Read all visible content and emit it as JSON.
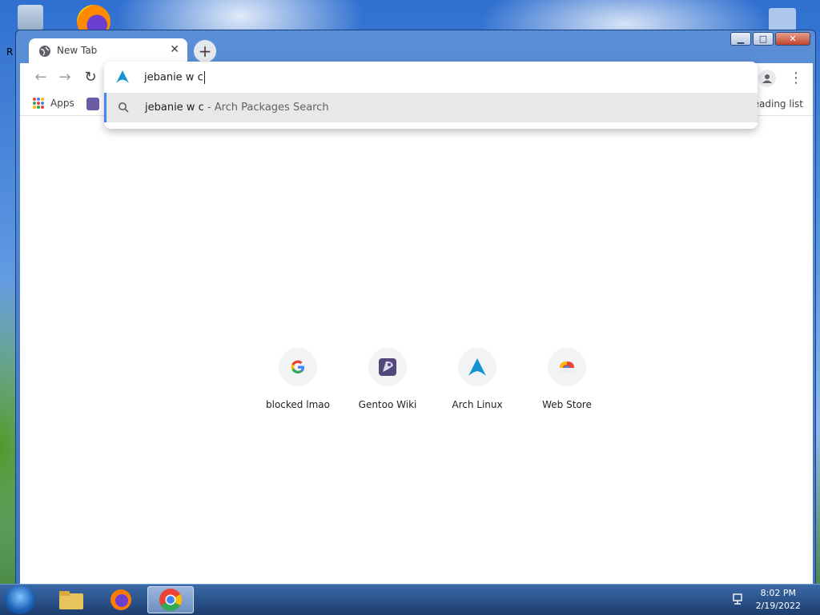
{
  "desktop": {
    "partial_label": "R"
  },
  "browser": {
    "tab": {
      "title": "New Tab"
    },
    "bookmarks": {
      "apps_label": "Apps",
      "reading_list": "Reading list"
    },
    "omnibox": {
      "query": "jebanie w c",
      "suggestion": {
        "query": "jebanie w c",
        "separator": " - ",
        "engine": "Arch Packages Search"
      }
    },
    "shortcuts": [
      {
        "label": "blocked lmao",
        "icon": "google-icon"
      },
      {
        "label": "Gentoo Wiki",
        "icon": "gentoo-icon"
      },
      {
        "label": "Arch Linux",
        "icon": "arch-linux-icon"
      },
      {
        "label": "Web Store",
        "icon": "web-store-icon"
      }
    ]
  },
  "taskbar": {
    "time": "8:02 PM",
    "date": "2/19/2022"
  },
  "colors": {
    "accent": "#4285f4",
    "arch_blue": "#1793d1"
  }
}
